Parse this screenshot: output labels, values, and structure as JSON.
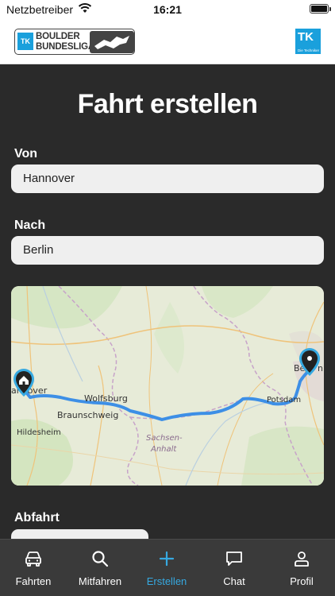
{
  "status_bar": {
    "carrier": "Netzbetreiber",
    "time": "16:21",
    "icons": [
      "wifi-icon",
      "battery-icon"
    ]
  },
  "header": {
    "logo_left": {
      "line1": "BOULDER",
      "line2": "BUNDESLIGA",
      "badge": "TK"
    },
    "logo_right": {
      "text": "TK",
      "subtext": "Die Techniker"
    }
  },
  "page": {
    "title": "Fahrt erstellen",
    "from": {
      "label": "Von",
      "value": "Hannover"
    },
    "to": {
      "label": "Nach",
      "value": "Berlin"
    },
    "departure": {
      "label": "Abfahrt",
      "value": ""
    }
  },
  "map": {
    "cities": [
      {
        "name": "Hannover",
        "shown": "annover"
      },
      {
        "name": "Hildesheim"
      },
      {
        "name": "Wolfsburg"
      },
      {
        "name": "Braunschweig"
      },
      {
        "name": "Sachsen-Anhalt",
        "shown_lines": [
          "Sachsen-",
          "Anhalt"
        ]
      },
      {
        "name": "Potsdam"
      },
      {
        "name": "Berlin",
        "shown": "Be  n"
      }
    ],
    "route_color": "#3d8fe6",
    "pin_color": "#222222",
    "pin_ring_color": "#36a9e1"
  },
  "tabs": [
    {
      "label": "Fahrten",
      "icon": "car-icon",
      "active": false
    },
    {
      "label": "Mitfahren",
      "icon": "search-icon",
      "active": false
    },
    {
      "label": "Erstellen",
      "icon": "plus-icon",
      "active": true
    },
    {
      "label": "Chat",
      "icon": "chat-bubble-icon",
      "active": false
    },
    {
      "label": "Profil",
      "icon": "person-icon",
      "active": false
    }
  ],
  "colors": {
    "accent": "#36a9e1",
    "background": "#2a2a2a",
    "field_bg": "#efefef",
    "tabbar_bg": "#3a3a3a"
  }
}
